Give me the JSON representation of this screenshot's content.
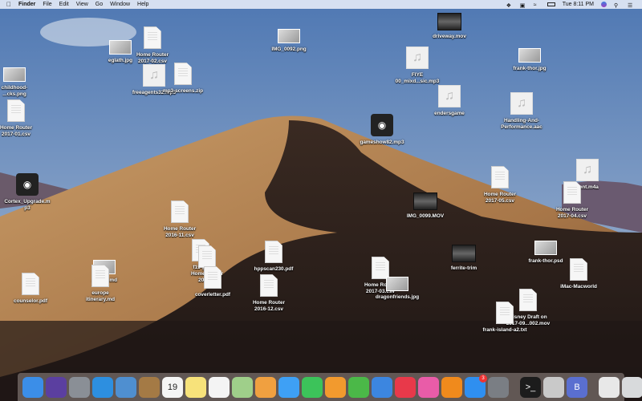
{
  "menubar": {
    "app": "Finder",
    "menus": [
      "File",
      "Edit",
      "View",
      "Go",
      "Window",
      "Help"
    ],
    "clock": "Tue 8:11 PM",
    "tray_icons": [
      "dropbox-icon",
      "airplay-icon",
      "wifi-icon",
      "battery-icon"
    ],
    "right_icons": [
      "siri-icon",
      "spotlight-search-icon",
      "notification-center-icon"
    ]
  },
  "desktop": {
    "icons": [
      {
        "label": "eglath.jpg",
        "type": "img",
        "icon": "image-file-icon"
      },
      {
        "label": "Home Router\n2017-02.csv",
        "type": "doc",
        "icon": "csv-file-icon"
      },
      {
        "label": "IMG_0092.png",
        "type": "img",
        "icon": "image-file-icon"
      },
      {
        "label": "childhood-\n...cks.png",
        "type": "img",
        "icon": "image-file-icon"
      },
      {
        "label": "freeagents32.mp3",
        "type": "music",
        "icon": "audio-file-icon"
      },
      {
        "label": "mp3-screens.zip",
        "type": "doc",
        "icon": "zip-file-icon"
      },
      {
        "label": "Home Router\n2017-01.csv",
        "type": "doc",
        "icon": "csv-file-icon"
      },
      {
        "label": "driveway.mov",
        "type": "vid",
        "icon": "video-file-icon"
      },
      {
        "label": "FIYE\n00_mixd...sic.mp3",
        "type": "music",
        "icon": "audio-file-icon"
      },
      {
        "label": "frank-thor.jpg",
        "type": "img",
        "icon": "image-file-icon"
      },
      {
        "label": "endersgame",
        "type": "music",
        "icon": "audio-file-icon"
      },
      {
        "label": "Handling-And-\nPerformance.aac",
        "type": "music",
        "icon": "audio-file-icon"
      },
      {
        "label": "gameshow82.mp3",
        "type": "app",
        "icon": "album-art-icon"
      },
      {
        "label": "Cortex_Upgrade.m\np3",
        "type": "app",
        "icon": "album-art-icon"
      },
      {
        "label": "Home Router\n2016-11.csv",
        "type": "doc",
        "icon": "csv-file-icon"
      },
      {
        "label": "IMG_0099.MOV",
        "type": "vid",
        "icon": "video-file-icon"
      },
      {
        "label": "Home Router\n2017-05.csv",
        "type": "doc",
        "icon": "csv-file-icon"
      },
      {
        "label": "lient.m4a",
        "type": "music",
        "icon": "audio-file-icon"
      },
      {
        "label": "Home Router\n2017-04.csv",
        "type": "doc",
        "icon": "csv-file-icon"
      },
      {
        "label": "counselor.pdf",
        "type": "doc",
        "icon": "pdf-file-icon"
      },
      {
        "label": "...color.md",
        "type": "img",
        "icon": "image-file-icon"
      },
      {
        "label": "europe\nitinerary.md",
        "type": "doc",
        "icon": "markdown-file-icon"
      },
      {
        "label": "f15-gif",
        "type": "doc",
        "icon": "gif-file-icon"
      },
      {
        "label": "Home Router\n2017-...",
        "type": "doc",
        "icon": "csv-file-icon"
      },
      {
        "label": "coverletter.pdf",
        "type": "doc",
        "icon": "pdf-file-icon"
      },
      {
        "label": "hppscan230.pdf",
        "type": "doc",
        "icon": "pdf-file-icon"
      },
      {
        "label": "Home Router\n2016-12.csv",
        "type": "doc",
        "icon": "csv-file-icon"
      },
      {
        "label": "Home Router\n2017-03.csv",
        "type": "doc",
        "icon": "csv-file-icon"
      },
      {
        "label": "dragonfriends.jpg",
        "type": "img",
        "icon": "image-file-icon"
      },
      {
        "label": "ferrite-trim",
        "type": "vid",
        "icon": "video-file-icon"
      },
      {
        "label": "frank-thor.psd",
        "type": "img",
        "icon": "image-file-icon"
      },
      {
        "label": "iMac-Macworld",
        "type": "doc",
        "icon": "pdf-file-icon"
      },
      {
        "label": "Disney Draft on\n2017-09...002.mov",
        "type": "doc",
        "icon": "quicktime-file-icon"
      },
      {
        "label": "frank-island-a2.txt",
        "type": "doc",
        "icon": "text-file-icon"
      }
    ]
  },
  "dock": {
    "apps": [
      {
        "name": "Finder",
        "icon": "finder-icon",
        "color": "#3b8ee8"
      },
      {
        "name": "Siri",
        "icon": "siri-icon",
        "color": "#5b3fa0"
      },
      {
        "name": "Launchpad",
        "icon": "launchpad-icon",
        "color": "#8a8f96"
      },
      {
        "name": "Safari",
        "icon": "safari-icon",
        "color": "#2d8fe0"
      },
      {
        "name": "Preview",
        "icon": "preview-icon",
        "color": "#4f8fd0"
      },
      {
        "name": "Contacts",
        "icon": "contacts-icon",
        "color": "#a47a45"
      },
      {
        "name": "Calendar",
        "icon": "calendar-icon",
        "color": "#f5f5f5",
        "text": "19"
      },
      {
        "name": "Notes",
        "icon": "notes-icon",
        "color": "#f7e27a"
      },
      {
        "name": "Reminders",
        "icon": "reminders-icon",
        "color": "#f4f4f4"
      },
      {
        "name": "Maps",
        "icon": "maps-icon",
        "color": "#9fcf8a"
      },
      {
        "name": "Photos",
        "icon": "photos-icon",
        "color": "#f0a040"
      },
      {
        "name": "Messages",
        "icon": "messages-icon",
        "color": "#3ea0f5"
      },
      {
        "name": "FaceTime",
        "icon": "facetime-icon",
        "color": "#3cc35a"
      },
      {
        "name": "Pages",
        "icon": "pages-icon",
        "color": "#f29a2e"
      },
      {
        "name": "Numbers",
        "icon": "numbers-icon",
        "color": "#4bb848"
      },
      {
        "name": "Keynote",
        "icon": "keynote-icon",
        "color": "#3c86e0"
      },
      {
        "name": "News",
        "icon": "news-icon",
        "color": "#e8394a"
      },
      {
        "name": "iTunes",
        "icon": "itunes-icon",
        "color": "#e95ca8"
      },
      {
        "name": "iBooks",
        "icon": "ibooks-icon",
        "color": "#f08a1c"
      },
      {
        "name": "App Store",
        "icon": "app-store-icon",
        "color": "#2f8ff0",
        "badge": "3"
      },
      {
        "name": "System Preferences",
        "icon": "system-preferences-icon",
        "color": "#7a7e84"
      },
      {
        "name": "Terminal",
        "icon": "terminal-icon",
        "color": "#1c1c1c",
        "sep_before": true,
        "text": ">_"
      },
      {
        "name": "Screenshot",
        "icon": "screenshot-icon",
        "color": "#c9c9c9"
      },
      {
        "name": "BBEdit",
        "icon": "bbedit-icon",
        "color": "#5a6fd0",
        "text": "B"
      },
      {
        "name": "Downloads",
        "icon": "downloads-stack-icon",
        "color": "#e8e8e8",
        "sep_before": true
      },
      {
        "name": "Trash",
        "icon": "trash-icon",
        "color": "#d8dadc"
      }
    ]
  }
}
